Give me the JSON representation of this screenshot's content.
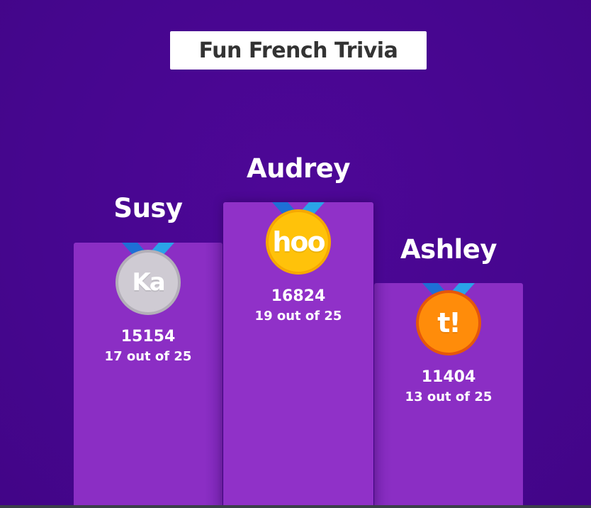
{
  "quiz": {
    "title": "Fun French Trivia"
  },
  "podium": {
    "first": {
      "name": "Audrey",
      "score": "16824",
      "correct": "19 out of 25",
      "medal_text": "hoo",
      "medal_color": "#ffc20a"
    },
    "second": {
      "name": "Susy",
      "score": "15154",
      "correct": "17 out of 25",
      "medal_text": "Ka",
      "medal_color": "#cfcbd3"
    },
    "third": {
      "name": "Ashley",
      "score": "11404",
      "correct": "13 out of 25",
      "medal_text": "t!",
      "medal_color": "#ff8c0a"
    }
  },
  "colors": {
    "background": "#46068f",
    "podium": "#8c2fc6",
    "ribbon_dark": "#1e6fd6",
    "ribbon_light": "#2aa3e8"
  }
}
